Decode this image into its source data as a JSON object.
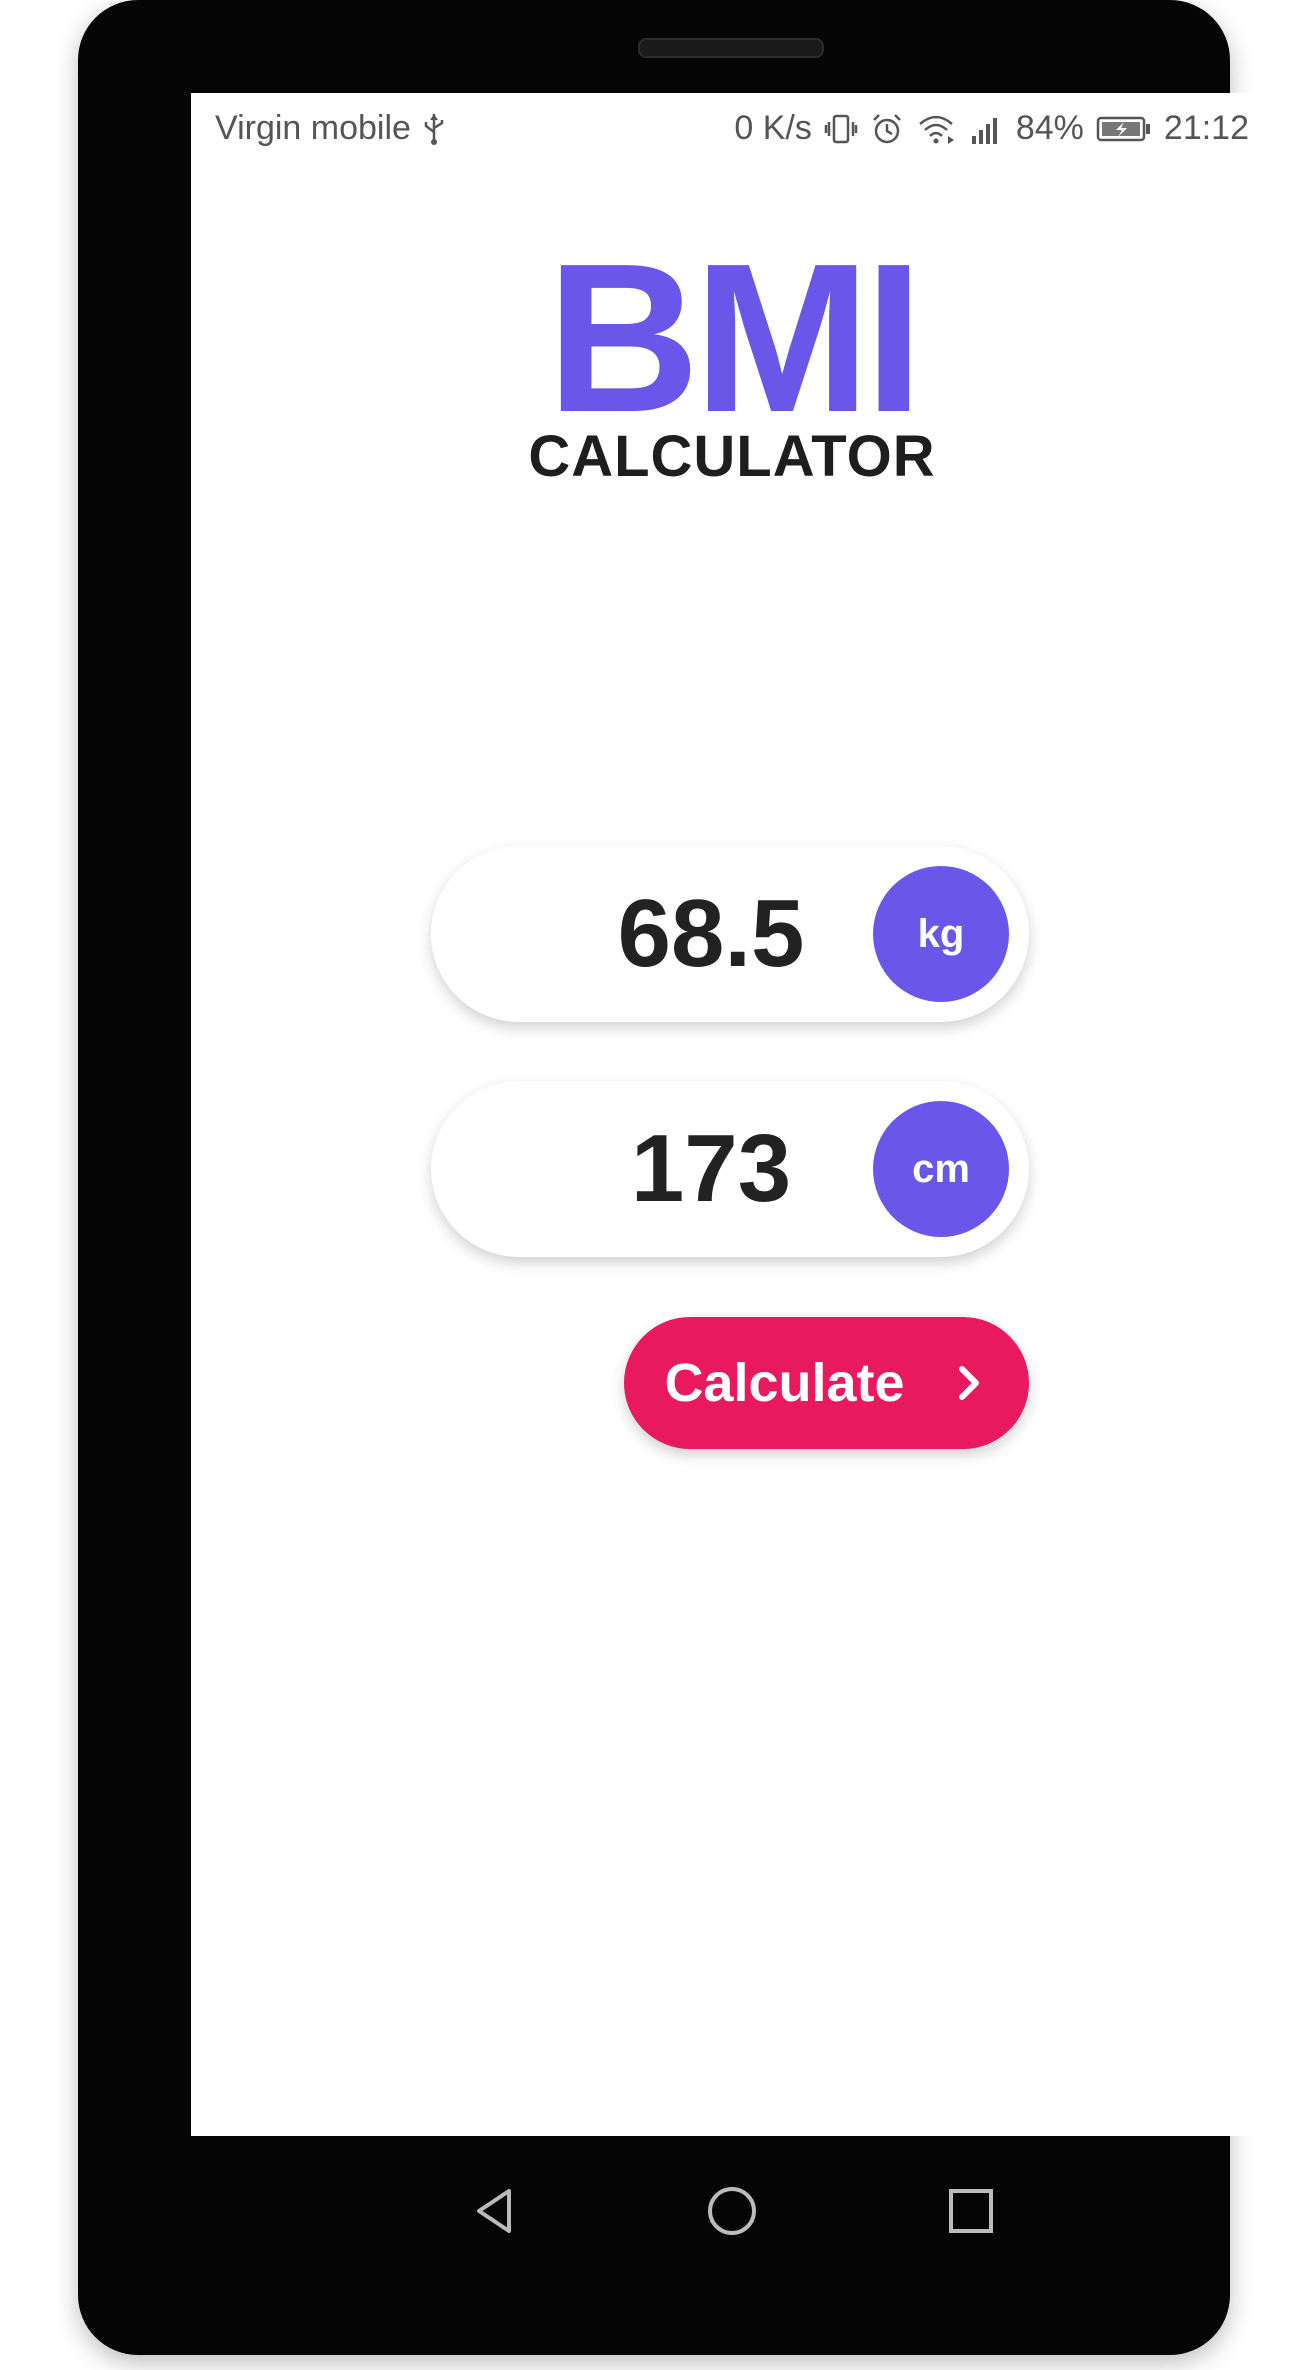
{
  "status_bar": {
    "carrier": "Virgin mobile",
    "net_speed": "0 K/s",
    "battery_percent": "84%",
    "time": "21:12",
    "icons": [
      "usb-icon",
      "vibrate-icon",
      "alarm-icon",
      "wifi-icon",
      "signal-icon",
      "battery-icon"
    ]
  },
  "logo": {
    "title": "BMI",
    "subtitle": "CALCULATOR"
  },
  "weight": {
    "value": "68.5",
    "unit": "kg"
  },
  "height": {
    "value": "173",
    "unit": "cm"
  },
  "calculate_button": {
    "label": "Calculate",
    "icon": "chevron-right-icon"
  },
  "nav_bar": {
    "icons": [
      "back-icon",
      "home-icon",
      "recents-icon"
    ]
  },
  "colors": {
    "accent": "#6a56e8",
    "button": "#e8195e",
    "text": "#222222"
  }
}
